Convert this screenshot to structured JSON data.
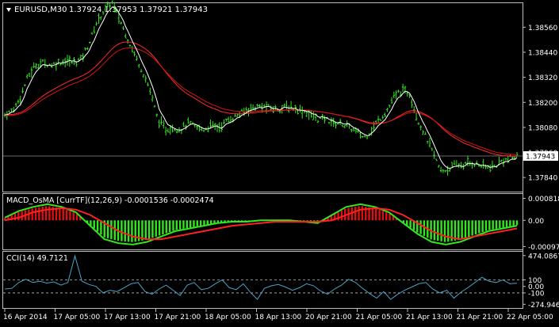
{
  "window": {
    "symbol_label": "EURUSD,M30",
    "ohlc": "1.37924 1.37953 1.37921 1.37943",
    "menu_arrow_icon": "triangle-down-icon"
  },
  "main_panel": {
    "price_ticks": [
      "1.38560",
      "1.38440",
      "1.38320",
      "1.38200",
      "1.38080",
      "1.37960",
      "1.37840"
    ],
    "current_price": "1.37943",
    "colors": {
      "bars": "#33e61f",
      "ma_fast": "#ffffff",
      "ma_slow_1": "#ff2a2a",
      "ma_slow_2": "#d41414",
      "price_line": "#8c8c8c"
    }
  },
  "macd_panel": {
    "label": "MACD_OsMA [CurrTF](12,26,9) -0.0001536 -0.0002474",
    "ticks": [
      "0.000818",
      "0.00",
      "-0.000974"
    ],
    "colors": {
      "hist_pos": "#e01010",
      "hist_neg": "#33e61f",
      "macd": "#33e61f",
      "signal": "#ff2020"
    }
  },
  "cci_panel": {
    "label": "CCI(14) 49.7121",
    "ticks": [
      "474.0867",
      "100",
      "0.00",
      "-100",
      "-274.9465"
    ],
    "colors": {
      "line": "#4aa3c8",
      "levels": "#bbbbbb"
    }
  },
  "time_axis": {
    "labels": [
      "16 Apr 2014",
      "17 Apr 05:00",
      "17 Apr 13:00",
      "17 Apr 21:00",
      "18 Apr 05:00",
      "18 Apr 13:00",
      "20 Apr 21:00",
      "21 Apr 05:00",
      "21 Apr 13:00",
      "21 Apr 21:00",
      "22 Apr 05:00"
    ]
  },
  "chart_data": {
    "type": "line",
    "series": [
      {
        "name": "EURUSD,M30",
        "values": [
          1.3814,
          1.3816,
          1.3822,
          1.3832,
          1.3838,
          1.3839,
          1.3838,
          1.3839,
          1.384,
          1.3839,
          1.3841,
          1.3848,
          1.3858,
          1.3864,
          1.3868,
          1.386,
          1.3851,
          1.3843,
          1.3835,
          1.3826,
          1.3812,
          1.3807,
          1.3808,
          1.3807,
          1.381,
          1.3808,
          1.3807,
          1.3809,
          1.3808,
          1.3811,
          1.3813,
          1.3815,
          1.3817,
          1.3818,
          1.3818,
          1.3817,
          1.3817,
          1.3818,
          1.3817,
          1.3816,
          1.3814,
          1.3812,
          1.3812,
          1.381,
          1.381,
          1.3808,
          1.3806,
          1.3803,
          1.3807,
          1.3812,
          1.3816,
          1.3823,
          1.3826,
          1.3824,
          1.3812,
          1.3804,
          1.3796,
          1.3787,
          1.3788,
          1.379,
          1.379,
          1.3791,
          1.379,
          1.3789,
          1.3789,
          1.3792,
          1.3793,
          1.3794
        ]
      },
      {
        "name": "MACD",
        "values": [
          0.0001,
          0.00035,
          0.0005,
          0.0006,
          0.0005,
          0.0003,
          -0.0002,
          -0.0007,
          -0.00085,
          -0.0009,
          -0.0008,
          -0.0006,
          -0.0004,
          -0.0003,
          -0.0002,
          -0.0001,
          -5e-05,
          -5e-05,
          0.0,
          0.0,
          0.0,
          -5e-05,
          -0.0001,
          0.0002,
          0.0005,
          0.0006,
          0.0005,
          0.0003,
          -0.0001,
          -0.0005,
          -0.0008,
          -0.0009,
          -0.0008,
          -0.0006,
          -0.0004,
          -0.0003,
          -0.0002
        ]
      },
      {
        "name": "Signal",
        "values": [
          0.0,
          0.0001,
          0.0003,
          0.0004,
          0.00045,
          0.0004,
          0.0002,
          -0.0001,
          -0.0004,
          -0.0006,
          -0.0007,
          -0.0007,
          -0.0006,
          -0.0005,
          -0.0004,
          -0.0003,
          -0.0002,
          -0.00015,
          -0.0001,
          -5e-05,
          -5e-05,
          -5e-05,
          -5e-05,
          0.0,
          0.0002,
          0.0004,
          0.00045,
          0.0004,
          0.0002,
          -0.0001,
          -0.0004,
          -0.0006,
          -0.0007,
          -0.0006,
          -0.0005,
          -0.0004,
          -0.0003
        ]
      },
      {
        "name": "CCI(14)",
        "values": [
          -40,
          -30,
          60,
          110,
          60,
          80,
          50,
          70,
          20,
          60,
          470,
          80,
          30,
          0,
          -100,
          -60,
          -80,
          -20,
          40,
          60,
          -80,
          -120,
          -40,
          20,
          -60,
          -140,
          20,
          60,
          -50,
          -30,
          40,
          100,
          -20,
          -50,
          40,
          -90,
          -200,
          -30,
          10,
          30,
          -10,
          -60,
          -20,
          40,
          10,
          -70,
          -120,
          -40,
          20,
          110,
          60,
          -30,
          -110,
          -180,
          -80,
          -200,
          -120,
          -60,
          -10,
          40,
          60,
          -40,
          -100,
          -60,
          -180,
          -90,
          -20,
          60,
          140,
          80,
          60,
          100,
          40,
          50
        ]
      }
    ],
    "ylim_price": [
      1.3778,
      1.3866
    ],
    "ylim_macd": [
      -0.00105,
      0.00095
    ],
    "ylim_cci": [
      -320,
      520
    ]
  }
}
